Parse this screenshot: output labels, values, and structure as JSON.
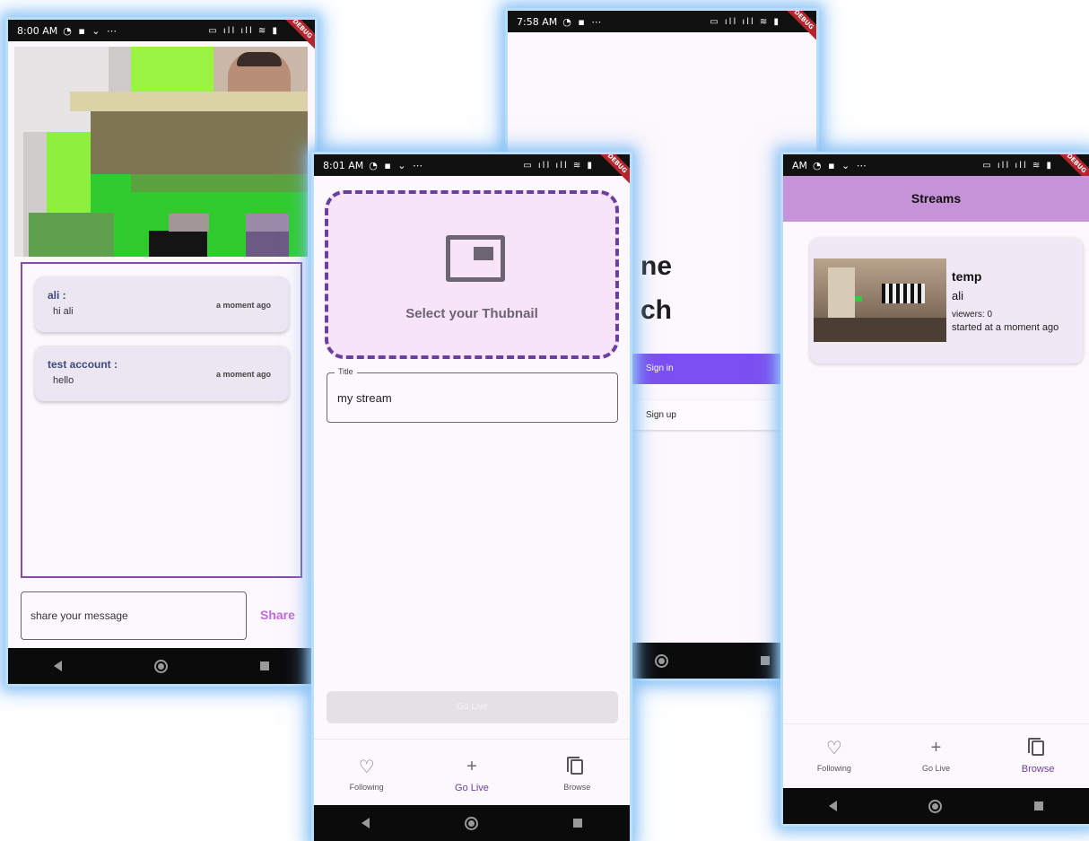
{
  "chat_screen": {
    "status_time": "8:00 AM",
    "messages": [
      {
        "user": "ali :",
        "text": "hi ali",
        "time": "a moment ago"
      },
      {
        "user": "test account  :",
        "text": "hello",
        "time": "a moment ago"
      }
    ],
    "input_placeholder": "share your message",
    "share_label": "Share"
  },
  "golive_screen": {
    "status_time": "8:01 AM",
    "thumbnail_label": "Select your Thubnail",
    "title_label": "Title",
    "title_value": "my stream",
    "go_live_button": "Go Live",
    "nav": [
      {
        "label": "Following",
        "icon": "heart-outline-icon"
      },
      {
        "label": "Go Live",
        "icon": "plus-icon",
        "active": true
      },
      {
        "label": "Browse",
        "icon": "copy-icon"
      }
    ]
  },
  "welcome_screen": {
    "status_time": "7:58 AM",
    "heading_line1": "ne",
    "heading_line2": "ch",
    "signin_label": "Sign in",
    "signup_label": "Sign up"
  },
  "streams_screen": {
    "status_time": "AM",
    "appbar_title": "Streams",
    "stream": {
      "name": "temp",
      "user": "ali",
      "viewers": "viewers: 0",
      "started": "started at a moment ago"
    },
    "nav": [
      {
        "label": "Following",
        "icon": "heart-outline-icon"
      },
      {
        "label": "Go Live",
        "icon": "plus-icon"
      },
      {
        "label": "Browse",
        "icon": "copy-icon",
        "active": true
      }
    ]
  },
  "debug_banner": "DEBUG",
  "colors": {
    "accent_purple": "#6b3fa0",
    "signin_purple": "#7b4ff0",
    "appbar_purple": "#c793d8",
    "share_pink": "#c26ad6",
    "glow_blue": "#93c8f5"
  }
}
